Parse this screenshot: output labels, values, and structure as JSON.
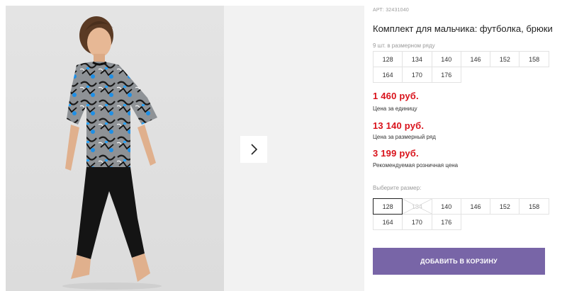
{
  "product": {
    "article_label": "АРТ:",
    "article_number": "32431040",
    "title": "Комплект для мальчика: футболка, брюки"
  },
  "row_pack": {
    "label": "9 шт. в размерном ряду",
    "sizes": [
      "128",
      "134",
      "140",
      "146",
      "152",
      "158",
      "164",
      "170",
      "176"
    ]
  },
  "prices": {
    "unit_price": "1 460 руб.",
    "unit_label": "Цена за единицу",
    "row_price": "13 140 руб.",
    "row_label": "Цена за размерный ряд",
    "retail_price": "3 199 руб.",
    "retail_label": "Рекомендуемая розничная цена"
  },
  "size_select": {
    "label": "Выберите размер:",
    "sizes": [
      "128",
      "134",
      "140",
      "146",
      "152",
      "158",
      "164",
      "170",
      "176"
    ],
    "selected": "128",
    "unavailable": [
      "134"
    ]
  },
  "actions": {
    "add_to_cart": "ДОБАВИТЬ В КОРЗИНУ"
  },
  "icons": {
    "next": "chevron-right-icon"
  },
  "colors": {
    "price_red": "#d9121b",
    "button_purple": "#7865a7"
  }
}
